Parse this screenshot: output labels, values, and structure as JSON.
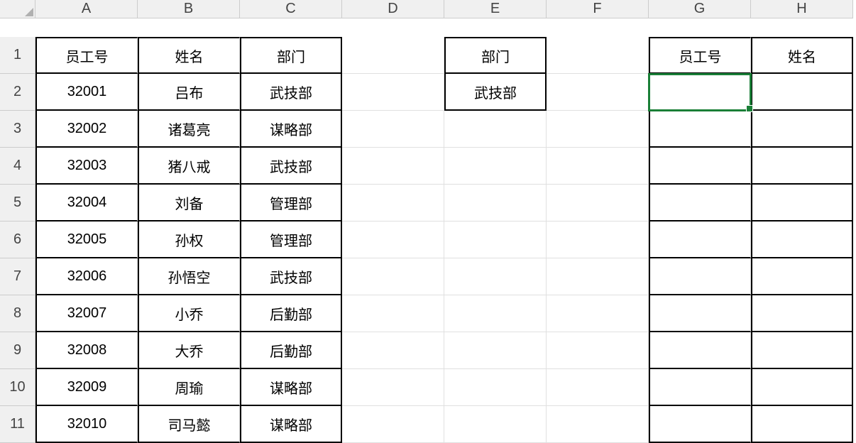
{
  "columns": [
    "A",
    "B",
    "C",
    "D",
    "E",
    "F",
    "G",
    "H"
  ],
  "rows": [
    "1",
    "2",
    "3",
    "4",
    "5",
    "6",
    "7",
    "8",
    "9",
    "10",
    "11"
  ],
  "tableHeaders": {
    "A": "员工号",
    "B": "姓名",
    "C": "部门"
  },
  "tableRows": [
    {
      "A": "32001",
      "B": "吕布",
      "C": "武技部"
    },
    {
      "A": "32002",
      "B": "诸葛亮",
      "C": "谋略部"
    },
    {
      "A": "32003",
      "B": "猪八戒",
      "C": "武技部"
    },
    {
      "A": "32004",
      "B": "刘备",
      "C": "管理部"
    },
    {
      "A": "32005",
      "B": "孙权",
      "C": "管理部"
    },
    {
      "A": "32006",
      "B": "孙悟空",
      "C": "武技部"
    },
    {
      "A": "32007",
      "B": "小乔",
      "C": "后勤部"
    },
    {
      "A": "32008",
      "B": "大乔",
      "C": "后勤部"
    },
    {
      "A": "32009",
      "B": "周瑜",
      "C": "谋略部"
    },
    {
      "A": "32010",
      "B": "司马懿",
      "C": "谋略部"
    }
  ],
  "lookup": {
    "E1": "部门",
    "E2": "武技部",
    "G1": "员工号",
    "H1": "姓名"
  },
  "selectedCell": "G2"
}
